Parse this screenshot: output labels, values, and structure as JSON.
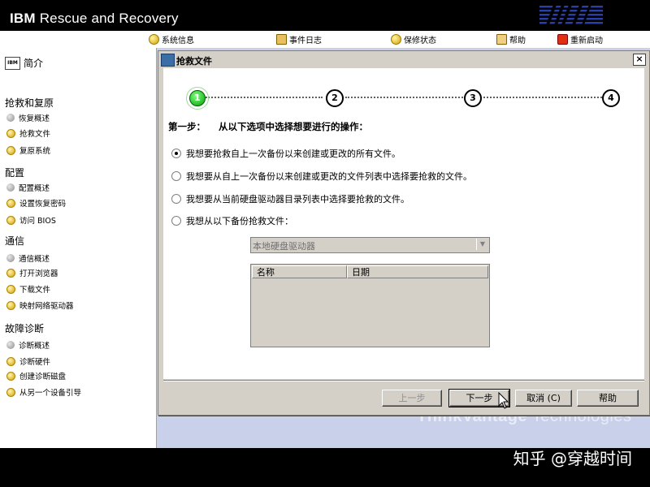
{
  "app": {
    "title_bold": "IBM",
    "title_rest": " Rescue and Recovery"
  },
  "toolbar": [
    {
      "label": "系统信息",
      "icon": "system-info-icon",
      "color": "#e0b000"
    },
    {
      "label": "事件日志",
      "icon": "event-log-icon",
      "color": "#c08000"
    },
    {
      "label": "保修状态",
      "icon": "warranty-icon",
      "color": "#e0b000"
    },
    {
      "label": "帮助",
      "icon": "help-icon",
      "color": "#d8a000"
    },
    {
      "label": "重新启动",
      "icon": "restart-icon",
      "color": "#d02000"
    }
  ],
  "sidebar": {
    "intro": "简介",
    "intro_icon_text": "IBM",
    "sections": [
      {
        "title": "抢救和复原",
        "items": [
          "恢复概述",
          "抢救文件",
          "复原系统"
        ]
      },
      {
        "title": "配置",
        "items": [
          "配置概述",
          "设置恢复密码",
          "访问 BIOS"
        ]
      },
      {
        "title": "通信",
        "items": [
          "通信概述",
          "打开浏览器",
          "下载文件",
          "映射网络驱动器"
        ]
      },
      {
        "title": "故障诊断",
        "items": [
          "诊断概述",
          "诊断硬件",
          "创建诊断磁盘",
          "从另一个设备引导"
        ]
      }
    ]
  },
  "dialog": {
    "title": "抢救文件",
    "close": "×",
    "steps": [
      "1",
      "2",
      "3",
      "4"
    ],
    "active_step": 1,
    "heading_label": "第一步：",
    "heading_text": "从以下选项中选择想要进行的操作：",
    "options": [
      "我想要抢救自上一次备份以来创建或更改的所有文件。",
      "我想要从自上一次备份以来创建或更改的文件列表中选择要抢救的文件。",
      "我想要从当前硬盘驱动器目录列表中选择要抢救的文件。",
      "我想从以下备份抢救文件："
    ],
    "selected_option": 0,
    "drive_select": "本地硬盘驱动器",
    "list_columns": [
      "名称",
      "日期"
    ],
    "buttons": {
      "back": "上一步",
      "next": "下一步",
      "cancel": "取消 (C)",
      "help": "帮助"
    }
  },
  "watermark": {
    "bold": "ThinkVantage",
    "rest": " Technologies"
  },
  "credit": "知乎 @穿越时间"
}
